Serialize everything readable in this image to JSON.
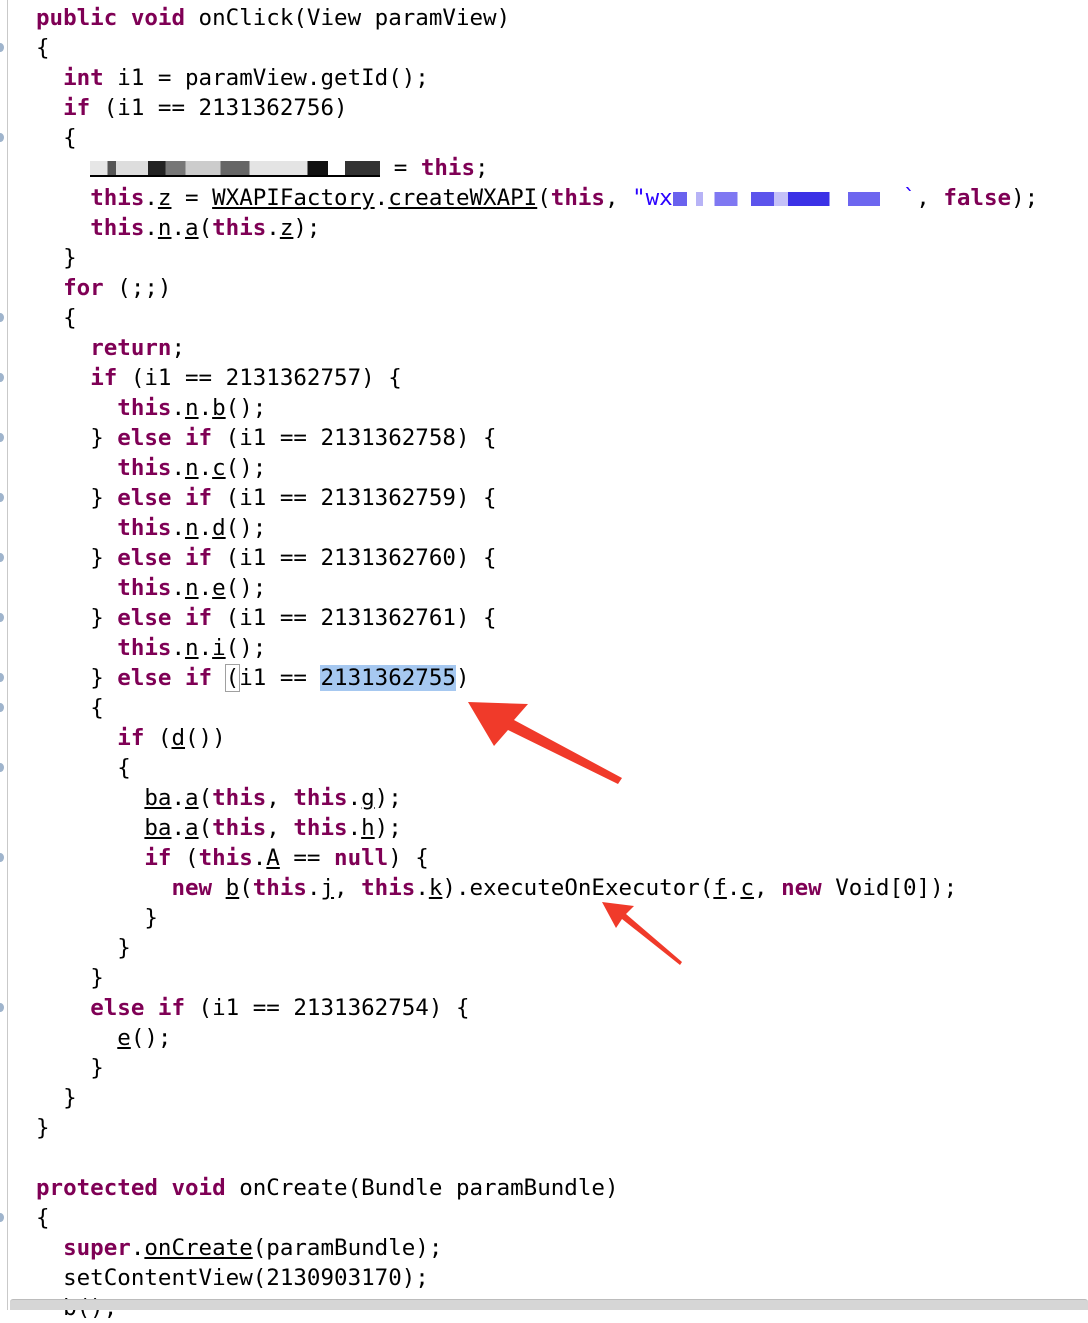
{
  "editor": {
    "language": "Java",
    "lines": [
      {
        "indent": 0,
        "tokens": [
          [
            "kw",
            "public"
          ],
          [
            "",
            " "
          ],
          [
            "kw",
            "void"
          ],
          [
            "",
            " onClick(View paramView)"
          ]
        ]
      },
      {
        "indent": 0,
        "tokens": [
          [
            "",
            "{"
          ]
        ]
      },
      {
        "indent": 1,
        "tokens": [
          [
            "kw",
            "int"
          ],
          [
            "",
            " i1 = paramView.getId();"
          ]
        ]
      },
      {
        "indent": 1,
        "tokens": [
          [
            "kw",
            "if"
          ],
          [
            "",
            " (i1 == 2131362756)"
          ]
        ]
      },
      {
        "indent": 1,
        "tokens": [
          [
            "",
            "{"
          ]
        ]
      },
      {
        "indent": 2,
        "tokens": [
          [
            "redact-dark",
            ""
          ],
          [
            "",
            " = "
          ],
          [
            "kw",
            "this"
          ],
          [
            "",
            ";"
          ]
        ]
      },
      {
        "indent": 2,
        "tokens": [
          [
            "kw",
            "this"
          ],
          [
            "",
            "."
          ],
          [
            "u",
            "z"
          ],
          [
            "",
            " = "
          ],
          [
            "u",
            "WXAPIFactory"
          ],
          [
            "",
            "."
          ],
          [
            "u",
            "createWXAPI"
          ],
          [
            "",
            "("
          ],
          [
            "kw",
            "this"
          ],
          [
            "",
            ", "
          ],
          [
            "str",
            "\"wx"
          ],
          [
            "redact-blue",
            ""
          ],
          [
            "str",
            "`"
          ],
          [
            "",
            ", "
          ],
          [
            "kw",
            "false"
          ],
          [
            "",
            ");"
          ]
        ]
      },
      {
        "indent": 2,
        "tokens": [
          [
            "kw",
            "this"
          ],
          [
            "",
            "."
          ],
          [
            "u",
            "n"
          ],
          [
            "",
            "."
          ],
          [
            "u",
            "a"
          ],
          [
            "",
            "("
          ],
          [
            "kw",
            "this"
          ],
          [
            "",
            "."
          ],
          [
            "u",
            "z"
          ],
          [
            "",
            ");"
          ]
        ]
      },
      {
        "indent": 1,
        "tokens": [
          [
            "",
            "}"
          ]
        ]
      },
      {
        "indent": 1,
        "tokens": [
          [
            "kw",
            "for"
          ],
          [
            "",
            " (;;)"
          ]
        ]
      },
      {
        "indent": 1,
        "tokens": [
          [
            "",
            "{"
          ]
        ]
      },
      {
        "indent": 2,
        "tokens": [
          [
            "kw",
            "return"
          ],
          [
            "",
            ";"
          ]
        ]
      },
      {
        "indent": 2,
        "tokens": [
          [
            "kw",
            "if"
          ],
          [
            "",
            " (i1 == 2131362757) {"
          ]
        ]
      },
      {
        "indent": 3,
        "tokens": [
          [
            "kw",
            "this"
          ],
          [
            "",
            "."
          ],
          [
            "u",
            "n"
          ],
          [
            "",
            "."
          ],
          [
            "u",
            "b"
          ],
          [
            "",
            "();"
          ]
        ]
      },
      {
        "indent": 2,
        "tokens": [
          [
            "",
            "} "
          ],
          [
            "kw",
            "else"
          ],
          [
            "",
            " "
          ],
          [
            "kw",
            "if"
          ],
          [
            "",
            " (i1 == 2131362758) {"
          ]
        ]
      },
      {
        "indent": 3,
        "tokens": [
          [
            "kw",
            "this"
          ],
          [
            "",
            "."
          ],
          [
            "u",
            "n"
          ],
          [
            "",
            "."
          ],
          [
            "u",
            "c"
          ],
          [
            "",
            "();"
          ]
        ]
      },
      {
        "indent": 2,
        "tokens": [
          [
            "",
            "} "
          ],
          [
            "kw",
            "else"
          ],
          [
            "",
            " "
          ],
          [
            "kw",
            "if"
          ],
          [
            "",
            " (i1 == 2131362759) {"
          ]
        ]
      },
      {
        "indent": 3,
        "tokens": [
          [
            "kw",
            "this"
          ],
          [
            "",
            "."
          ],
          [
            "u",
            "n"
          ],
          [
            "",
            "."
          ],
          [
            "u",
            "d"
          ],
          [
            "",
            "();"
          ]
        ]
      },
      {
        "indent": 2,
        "tokens": [
          [
            "",
            "} "
          ],
          [
            "kw",
            "else"
          ],
          [
            "",
            " "
          ],
          [
            "kw",
            "if"
          ],
          [
            "",
            " (i1 == 2131362760) {"
          ]
        ]
      },
      {
        "indent": 3,
        "tokens": [
          [
            "kw",
            "this"
          ],
          [
            "",
            "."
          ],
          [
            "u",
            "n"
          ],
          [
            "",
            "."
          ],
          [
            "u",
            "e"
          ],
          [
            "",
            "();"
          ]
        ]
      },
      {
        "indent": 2,
        "tokens": [
          [
            "",
            "} "
          ],
          [
            "kw",
            "else"
          ],
          [
            "",
            " "
          ],
          [
            "kw",
            "if"
          ],
          [
            "",
            " (i1 == 2131362761) {"
          ]
        ]
      },
      {
        "indent": 3,
        "tokens": [
          [
            "kw",
            "this"
          ],
          [
            "",
            "."
          ],
          [
            "u",
            "n"
          ],
          [
            "",
            "."
          ],
          [
            "u",
            "i"
          ],
          [
            "",
            "();"
          ]
        ]
      },
      {
        "indent": 2,
        "tokens": [
          [
            "",
            "} "
          ],
          [
            "kw",
            "else"
          ],
          [
            "",
            " "
          ],
          [
            "kw",
            "if"
          ],
          [
            "",
            " "
          ],
          [
            "box",
            "("
          ],
          [
            "",
            "i1 == "
          ],
          [
            "sel",
            "2131362755"
          ],
          [
            "",
            ")"
          ]
        ]
      },
      {
        "indent": 2,
        "tokens": [
          [
            "",
            "{"
          ]
        ]
      },
      {
        "indent": 3,
        "tokens": [
          [
            "kw",
            "if"
          ],
          [
            "",
            " ("
          ],
          [
            "u",
            "d"
          ],
          [
            "",
            "())"
          ]
        ]
      },
      {
        "indent": 3,
        "tokens": [
          [
            "",
            "{"
          ]
        ]
      },
      {
        "indent": 4,
        "tokens": [
          [
            "u",
            "ba"
          ],
          [
            "",
            "."
          ],
          [
            "u",
            "a"
          ],
          [
            "",
            "("
          ],
          [
            "kw",
            "this"
          ],
          [
            "",
            ", "
          ],
          [
            "kw",
            "this"
          ],
          [
            "",
            "."
          ],
          [
            "u",
            "g"
          ],
          [
            "",
            ");"
          ]
        ]
      },
      {
        "indent": 4,
        "tokens": [
          [
            "u",
            "ba"
          ],
          [
            "",
            "."
          ],
          [
            "u",
            "a"
          ],
          [
            "",
            "("
          ],
          [
            "kw",
            "this"
          ],
          [
            "",
            ", "
          ],
          [
            "kw",
            "this"
          ],
          [
            "",
            "."
          ],
          [
            "u",
            "h"
          ],
          [
            "",
            ");"
          ]
        ]
      },
      {
        "indent": 4,
        "tokens": [
          [
            "kw",
            "if"
          ],
          [
            "",
            " ("
          ],
          [
            "kw",
            "this"
          ],
          [
            "",
            "."
          ],
          [
            "u",
            "A"
          ],
          [
            "",
            " == "
          ],
          [
            "kw",
            "null"
          ],
          [
            "",
            ") {"
          ]
        ]
      },
      {
        "indent": 5,
        "tokens": [
          [
            "kw",
            "new"
          ],
          [
            "",
            " "
          ],
          [
            "u",
            "b"
          ],
          [
            "",
            "("
          ],
          [
            "kw",
            "this"
          ],
          [
            "",
            "."
          ],
          [
            "u",
            "j"
          ],
          [
            "",
            ", "
          ],
          [
            "kw",
            "this"
          ],
          [
            "",
            "."
          ],
          [
            "u",
            "k"
          ],
          [
            "",
            ").executeOnExecutor("
          ],
          [
            "u",
            "f"
          ],
          [
            "",
            "."
          ],
          [
            "u",
            "c"
          ],
          [
            "",
            ", "
          ],
          [
            "kw",
            "new"
          ],
          [
            "",
            " Void[0]);"
          ]
        ]
      },
      {
        "indent": 4,
        "tokens": [
          [
            "",
            "}"
          ]
        ]
      },
      {
        "indent": 3,
        "tokens": [
          [
            "",
            "}"
          ]
        ]
      },
      {
        "indent": 2,
        "tokens": [
          [
            "",
            "}"
          ]
        ]
      },
      {
        "indent": 2,
        "tokens": [
          [
            "kw",
            "else"
          ],
          [
            "",
            " "
          ],
          [
            "kw",
            "if"
          ],
          [
            "",
            " (i1 == 2131362754) {"
          ]
        ]
      },
      {
        "indent": 3,
        "tokens": [
          [
            "u",
            "e"
          ],
          [
            "",
            "();"
          ]
        ]
      },
      {
        "indent": 2,
        "tokens": [
          [
            "",
            "}"
          ]
        ]
      },
      {
        "indent": 1,
        "tokens": [
          [
            "",
            "}"
          ]
        ]
      },
      {
        "indent": 0,
        "tokens": [
          [
            "",
            "}"
          ]
        ]
      },
      {
        "indent": 0,
        "tokens": []
      },
      {
        "indent": 0,
        "tokens": [
          [
            "kw",
            "protected"
          ],
          [
            "",
            " "
          ],
          [
            "kw",
            "void"
          ],
          [
            "",
            " onCreate(Bundle paramBundle)"
          ]
        ]
      },
      {
        "indent": 0,
        "tokens": [
          [
            "",
            "{"
          ]
        ]
      },
      {
        "indent": 1,
        "tokens": [
          [
            "kw",
            "super"
          ],
          [
            "",
            "."
          ],
          [
            "u",
            "onCreate"
          ],
          [
            "",
            "(paramBundle);"
          ]
        ]
      },
      {
        "indent": 1,
        "tokens": [
          [
            "",
            "setContentView(2130903170);"
          ]
        ]
      },
      {
        "indent": 1,
        "tokens": [
          [
            "",
            "b();"
          ]
        ]
      }
    ],
    "gutter_marker_lines": [
      1,
      4,
      10,
      12,
      14,
      16,
      18,
      20,
      22,
      23,
      25,
      28,
      33,
      40
    ]
  },
  "annotations": {
    "arrow_color": "#f03a2a",
    "arrows": [
      {
        "points_to": "selected constant 2131362755",
        "size": "large"
      },
      {
        "points_to": "executeOnExecutor call",
        "size": "small"
      }
    ]
  },
  "colors": {
    "keyword": "#7f0055",
    "string": "#2a00ff",
    "selection": "#a6c8f0"
  }
}
